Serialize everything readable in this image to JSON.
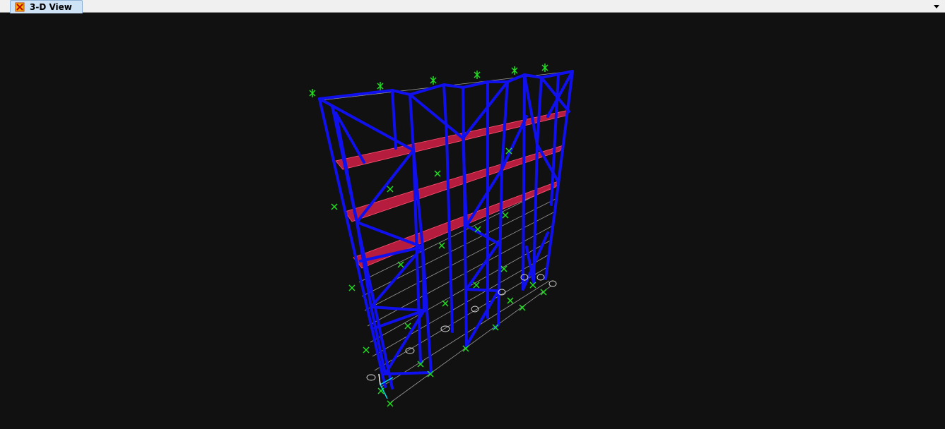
{
  "window": {
    "tab_label": "3-D View",
    "tab_icon": "sap-model-icon",
    "dropdown_icon": "chevron-down-icon"
  },
  "view": {
    "type": "3D structural model",
    "background": "#111111",
    "frame_color": "#1010ee",
    "slab_color": "#d21e46",
    "support_color": "#22dd22",
    "grid_color": "#9a9a9a"
  }
}
